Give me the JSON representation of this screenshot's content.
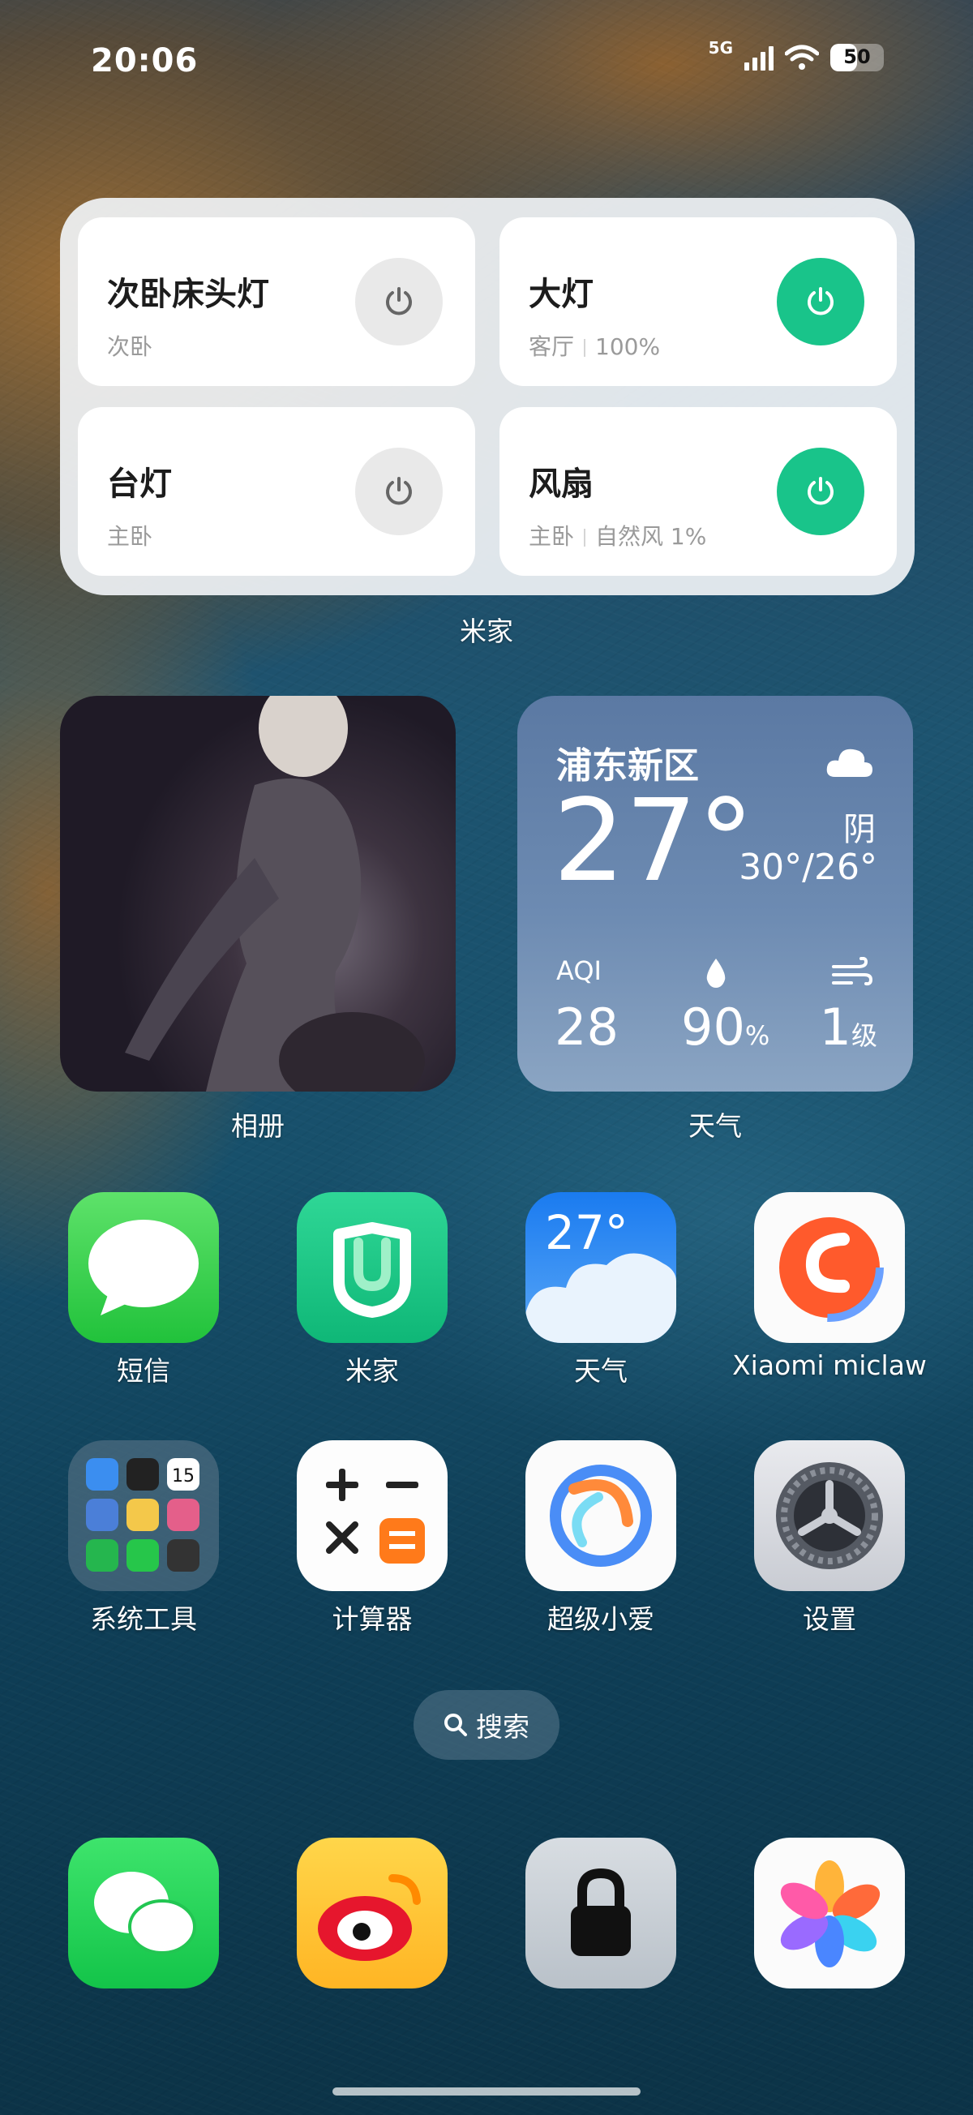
{
  "status": {
    "time": "20:06",
    "network": "5G",
    "battery": 50
  },
  "mijia_widget": {
    "label": "米家",
    "devices": [
      {
        "name": "次卧床头灯",
        "room": "次卧",
        "state": "",
        "on": false
      },
      {
        "name": "大灯",
        "room": "客厅",
        "state": "100%",
        "on": true
      },
      {
        "name": "台灯",
        "room": "主卧",
        "state": "",
        "on": false
      },
      {
        "name": "风扇",
        "room": "主卧",
        "state": "自然风 1%",
        "on": true
      }
    ]
  },
  "album_widget": {
    "label": "相册"
  },
  "weather_widget": {
    "label": "天气",
    "city": "浦东新区",
    "temp": "27°",
    "condition": "阴",
    "range": "30°/26°",
    "aqi_label": "AQI",
    "aqi": "28",
    "humidity": "90",
    "humidity_unit": "%",
    "wind": "1",
    "wind_unit": "级"
  },
  "apps_row1": [
    {
      "label": "短信",
      "icon": "message-icon"
    },
    {
      "label": "米家",
      "icon": "mijia-icon"
    },
    {
      "label": "天气",
      "icon": "weather-icon",
      "icon_text": "27°"
    },
    {
      "label": "Xiaomi miclaw",
      "icon": "miclaw-icon"
    }
  ],
  "apps_row2": [
    {
      "label": "系统工具",
      "icon": "system-tools-folder-icon",
      "folder_date": "15"
    },
    {
      "label": "计算器",
      "icon": "calculator-icon"
    },
    {
      "label": "超级小爱",
      "icon": "xiaoai-icon"
    },
    {
      "label": "设置",
      "icon": "settings-icon"
    }
  ],
  "search": {
    "label": "搜索"
  },
  "dock": [
    {
      "icon": "wechat-icon"
    },
    {
      "icon": "weibo-icon"
    },
    {
      "icon": "lock-icon"
    },
    {
      "icon": "gallery-icon"
    }
  ]
}
